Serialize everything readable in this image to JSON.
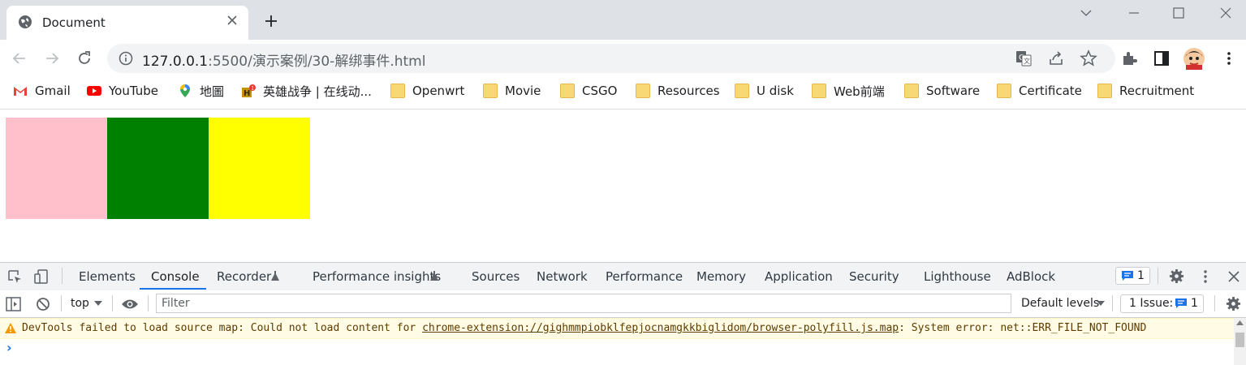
{
  "browser": {
    "tab_title": "Document",
    "url_host": "127.0.0.1",
    "url_rest": ":5500/演示案例/30-解绑事件.html"
  },
  "bookmarks": [
    {
      "label": "Gmail",
      "icon": "gmail-icon"
    },
    {
      "label": "YouTube",
      "icon": "youtube-icon"
    },
    {
      "label": "地圖",
      "icon": "maps-icon"
    },
    {
      "label": "英雄战争 | 在线动...",
      "icon": "game-icon"
    },
    {
      "label": "Openwrt",
      "icon": "folder-icon"
    },
    {
      "label": "Movie",
      "icon": "folder-icon"
    },
    {
      "label": "CSGO",
      "icon": "folder-icon"
    },
    {
      "label": "Resources",
      "icon": "folder-icon"
    },
    {
      "label": "U disk",
      "icon": "folder-icon"
    },
    {
      "label": "Web前端",
      "icon": "folder-icon"
    },
    {
      "label": "Software",
      "icon": "folder-icon"
    },
    {
      "label": "Certificate",
      "icon": "folder-icon"
    },
    {
      "label": "Recruitment",
      "icon": "folder-icon"
    }
  ],
  "page": {
    "boxes": [
      {
        "color": "#ffc0cb"
      },
      {
        "color": "#008000"
      },
      {
        "color": "#ffff00"
      }
    ]
  },
  "devtools": {
    "tabs": [
      "Elements",
      "Console",
      "Recorder",
      "Performance insights",
      "Sources",
      "Network",
      "Performance",
      "Memory",
      "Application",
      "Security",
      "Lighthouse",
      "AdBlock"
    ],
    "active_tab": "Console",
    "issues_badge": "1",
    "context": "top",
    "filter_placeholder": "Filter",
    "levels": "Default levels",
    "issue_label": "1 Issue:",
    "issue_count": "1",
    "message_prefix": "DevTools failed to load source map: Could not load content for ",
    "message_link": "chrome-extension://gighmmpiobklfepjocnamgkkbiglidom/browser-polyfill.js.map",
    "message_suffix": ": System error: net::ERR_FILE_NOT_FOUND",
    "prompt": "›"
  }
}
